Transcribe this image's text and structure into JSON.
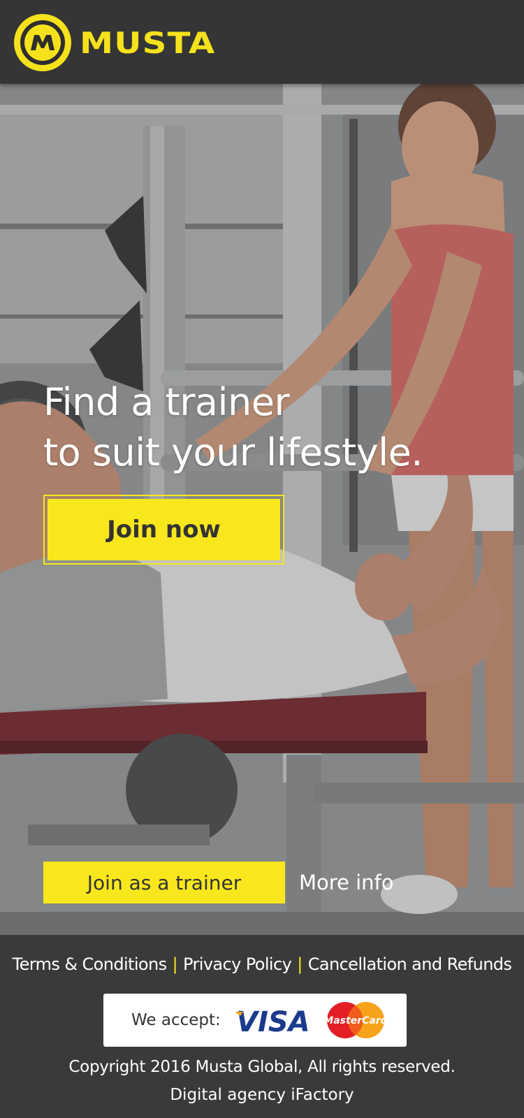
{
  "header": {
    "brand_name": "MUSTA",
    "logo_letter": "M"
  },
  "hero": {
    "headline_line1": "Find a trainer",
    "headline_line2": "to suit your lifestyle.",
    "join_now_label": "Join now",
    "join_trainer_label": "Join as a trainer",
    "more_info_label": "More info",
    "image_description_icon": "gym-photo"
  },
  "footer": {
    "links": [
      "Terms & Conditions",
      "Privacy Policy",
      "Cancellation and Refunds"
    ],
    "separator": "|",
    "we_accept_label": "We accept:",
    "visa_label": "VISA",
    "mastercard_label": "MasterCard",
    "copyright": "Copyright 2016 Musta Global, All rights reserved.",
    "agency": "Digital agency iFactory"
  },
  "colors": {
    "accent_yellow": "#f8e71c",
    "header_bg": "#353535",
    "footer_bg": "#3a3a3a",
    "button_text": "#333333"
  }
}
